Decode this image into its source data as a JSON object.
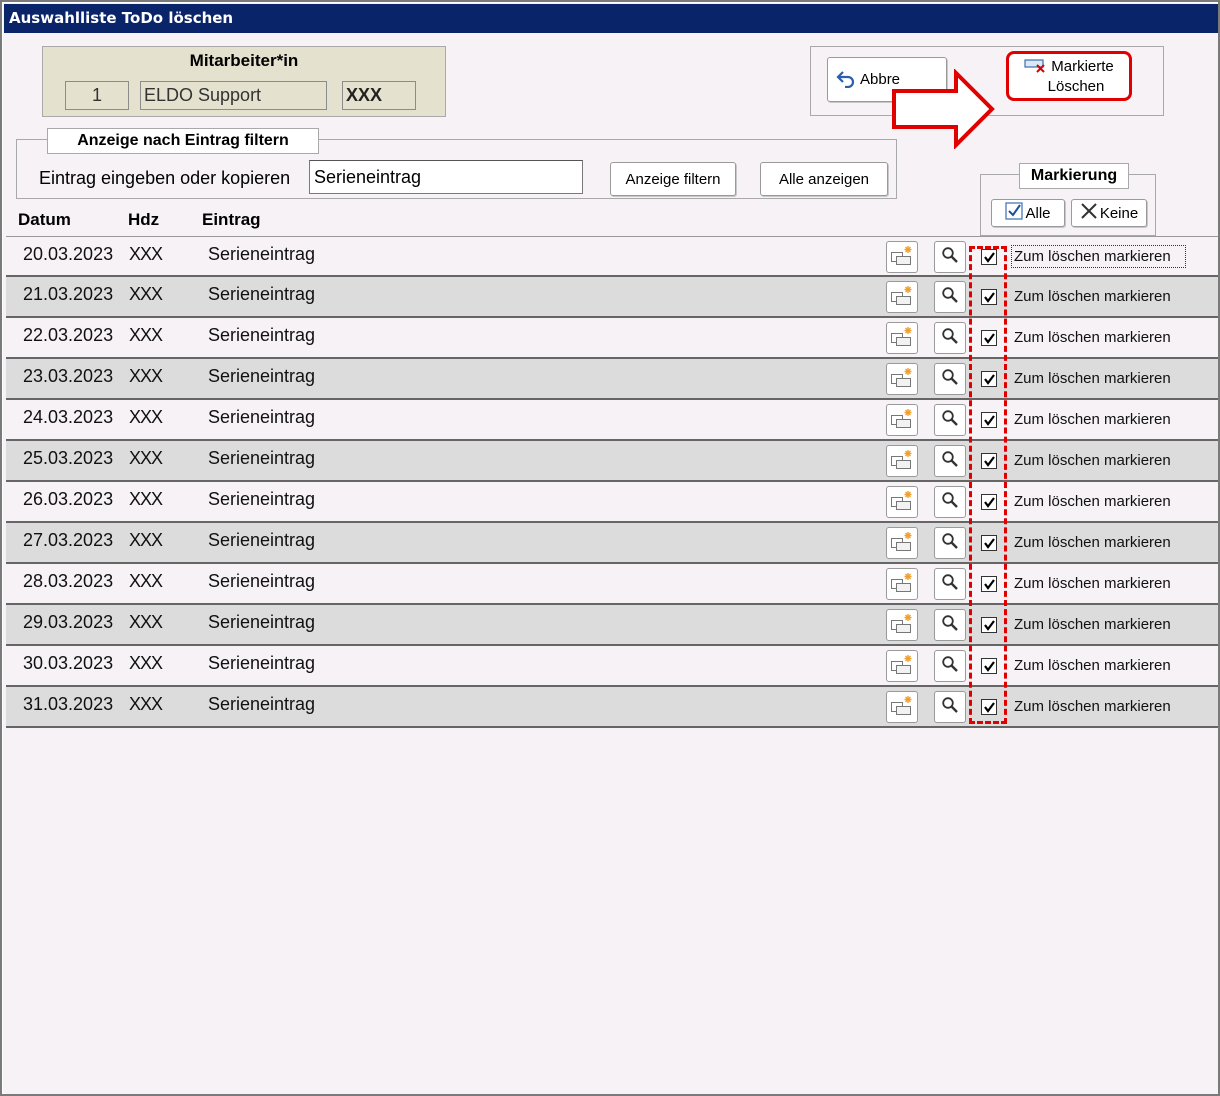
{
  "window": {
    "title": "Auswahlliste ToDo löschen"
  },
  "employee": {
    "title": "Mitarbeiter*in",
    "id": "1",
    "name": "ELDO Support",
    "code": "XXX"
  },
  "actions": {
    "cancel_label": "Abbre",
    "delete_marked_line1": "Markierte",
    "delete_marked_line2": "Löschen"
  },
  "filter": {
    "legend": "Anzeige nach Eintrag filtern",
    "label": "Eintrag eingeben oder kopieren",
    "input_value": "Serieneintrag",
    "filter_button": "Anzeige filtern",
    "show_all_button": "Alle anzeigen"
  },
  "marking": {
    "legend": "Markierung",
    "all_button": "Alle",
    "none_button": "Keine"
  },
  "columns": {
    "date": "Datum",
    "hdz": "Hdz",
    "entry": "Eintrag"
  },
  "rows": [
    {
      "date": "20.03.2023",
      "hdz": "XXX",
      "entry": "Serieneintrag",
      "checked": true,
      "check_label": "Zum löschen markieren"
    },
    {
      "date": "21.03.2023",
      "hdz": "XXX",
      "entry": "Serieneintrag",
      "checked": true,
      "check_label": "Zum löschen markieren"
    },
    {
      "date": "22.03.2023",
      "hdz": "XXX",
      "entry": "Serieneintrag",
      "checked": true,
      "check_label": "Zum löschen markieren"
    },
    {
      "date": "23.03.2023",
      "hdz": "XXX",
      "entry": "Serieneintrag",
      "checked": true,
      "check_label": "Zum löschen markieren"
    },
    {
      "date": "24.03.2023",
      "hdz": "XXX",
      "entry": "Serieneintrag",
      "checked": true,
      "check_label": "Zum löschen markieren"
    },
    {
      "date": "25.03.2023",
      "hdz": "XXX",
      "entry": "Serieneintrag",
      "checked": true,
      "check_label": "Zum löschen markieren"
    },
    {
      "date": "26.03.2023",
      "hdz": "XXX",
      "entry": "Serieneintrag",
      "checked": true,
      "check_label": "Zum löschen markieren"
    },
    {
      "date": "27.03.2023",
      "hdz": "XXX",
      "entry": "Serieneintrag",
      "checked": true,
      "check_label": "Zum löschen markieren"
    },
    {
      "date": "28.03.2023",
      "hdz": "XXX",
      "entry": "Serieneintrag",
      "checked": true,
      "check_label": "Zum löschen markieren"
    },
    {
      "date": "29.03.2023",
      "hdz": "XXX",
      "entry": "Serieneintrag",
      "checked": true,
      "check_label": "Zum löschen markieren"
    },
    {
      "date": "30.03.2023",
      "hdz": "XXX",
      "entry": "Serieneintrag",
      "checked": true,
      "check_label": "Zum löschen markieren"
    },
    {
      "date": "31.03.2023",
      "hdz": "XXX",
      "entry": "Serieneintrag",
      "checked": true,
      "check_label": "Zum löschen markieren"
    }
  ],
  "icons": {
    "copy": "copy-entry-icon",
    "search": "magnifier-icon",
    "undo": "undo-arrow-icon",
    "delete": "delete-marked-icon"
  },
  "colors": {
    "titlebar": "#0a246a",
    "highlight": "#e00000",
    "panel": "#e4e1cf",
    "row_alt": "#dcdcdc"
  }
}
